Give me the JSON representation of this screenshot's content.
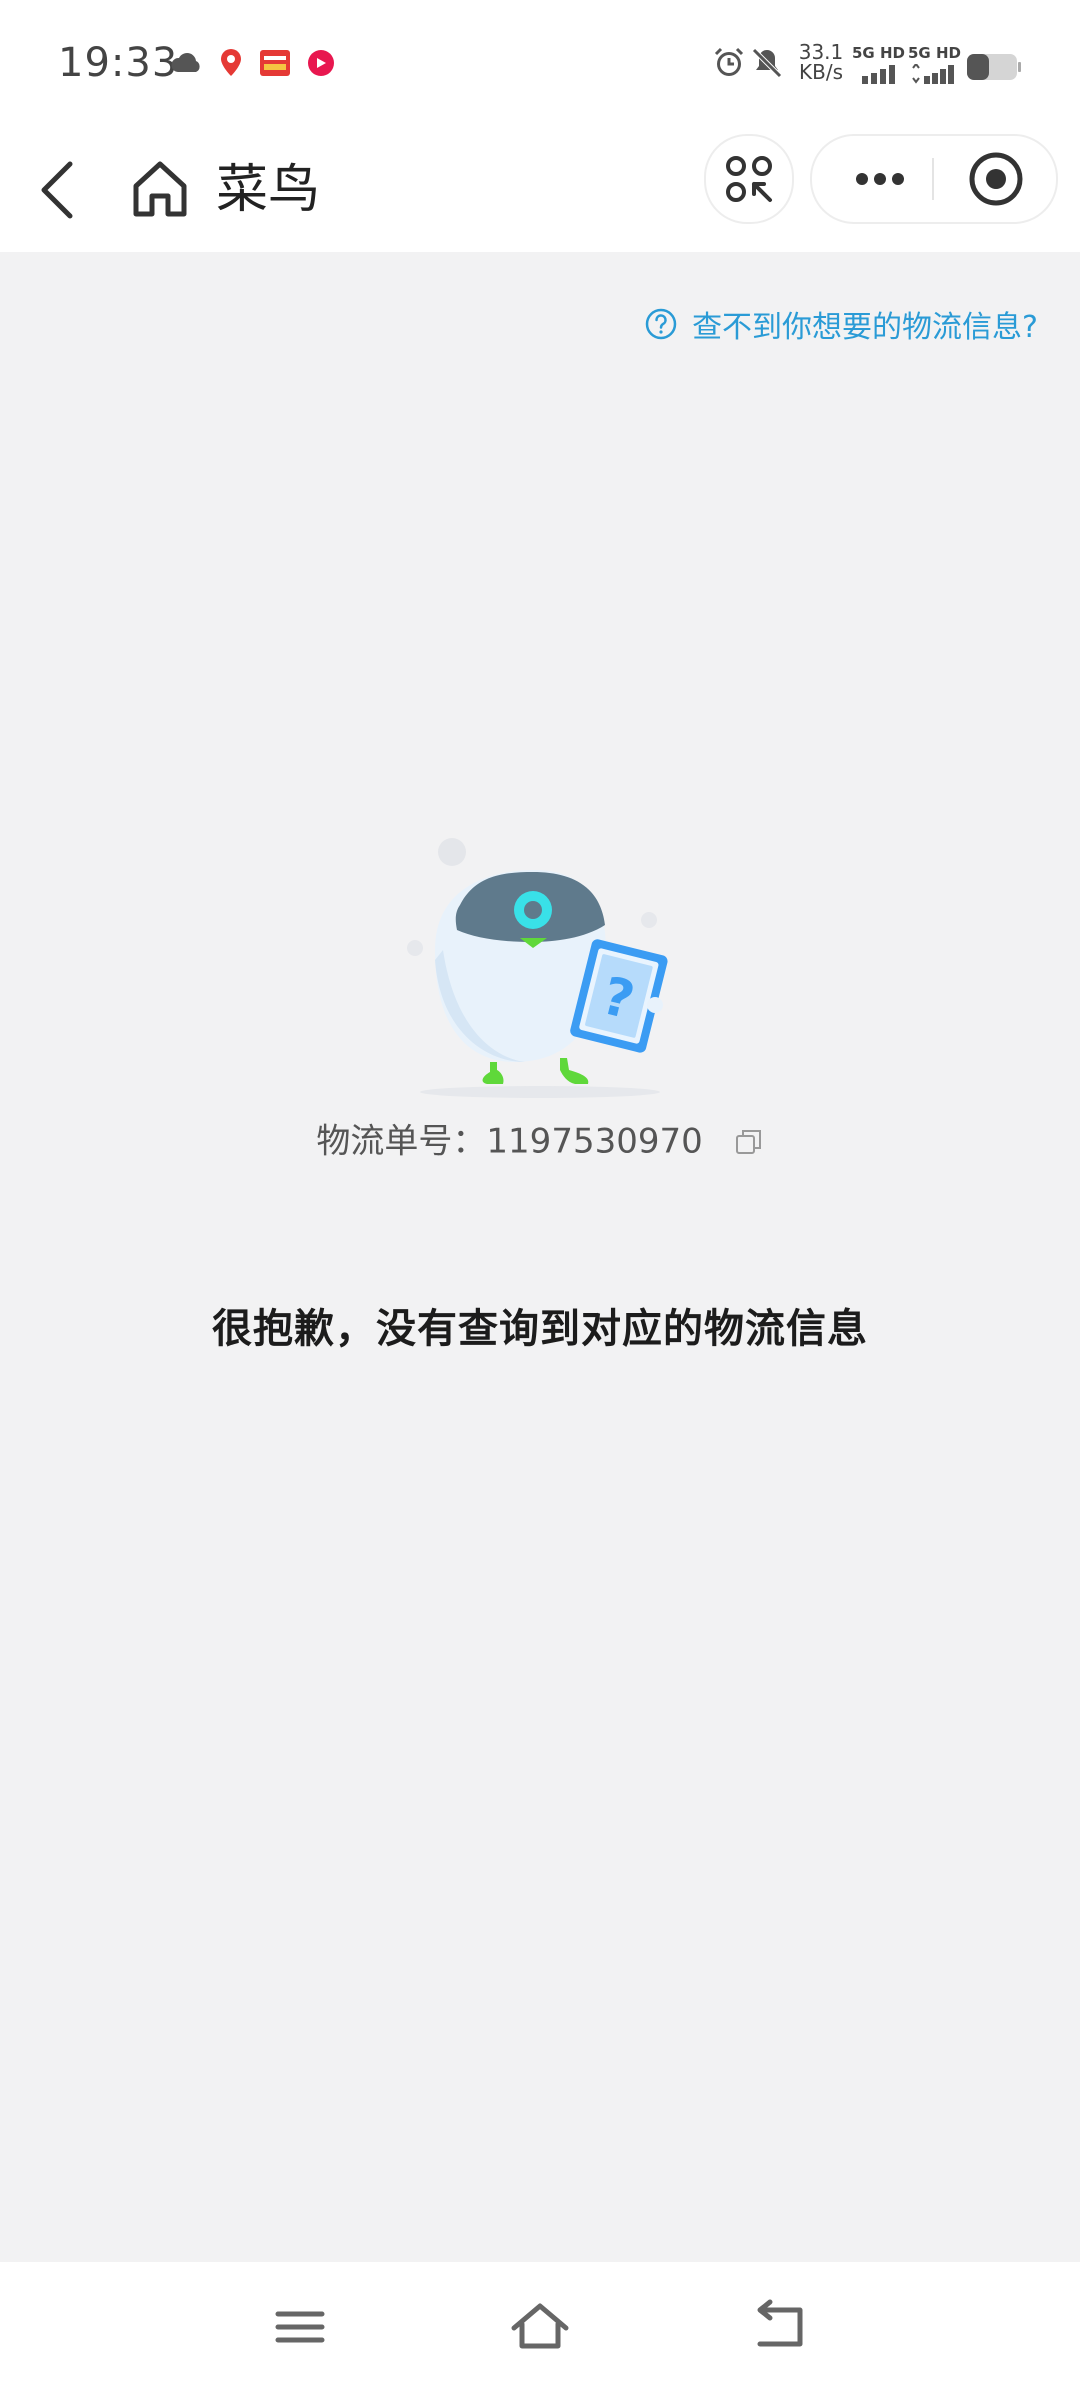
{
  "status_bar": {
    "time": "19:33",
    "net_speed_value": "33.1",
    "net_speed_unit": "KB/s",
    "sim1_label": "5G HD",
    "sim2_label": "5G HD",
    "icons": [
      "cloud-icon",
      "maps-app-icon",
      "toutiao-app-icon",
      "music-app-icon",
      "alarm-icon",
      "mute-icon",
      "signal-icon",
      "battery-icon"
    ]
  },
  "nav": {
    "title": "菜鸟",
    "icons": [
      "back-arrow-icon",
      "home-icon",
      "scan-icon",
      "more-icon",
      "close-target-icon"
    ]
  },
  "help": {
    "label": "查不到你想要的物流信息?",
    "color": "#2a9bd6"
  },
  "tracking": {
    "label": "物流单号：",
    "number": "1197530970"
  },
  "empty_state": {
    "message": "很抱歉，没有查询到对应的物流信息"
  },
  "system_nav": {
    "icons": [
      "menu-icon",
      "home-outline-icon",
      "back-icon"
    ]
  }
}
